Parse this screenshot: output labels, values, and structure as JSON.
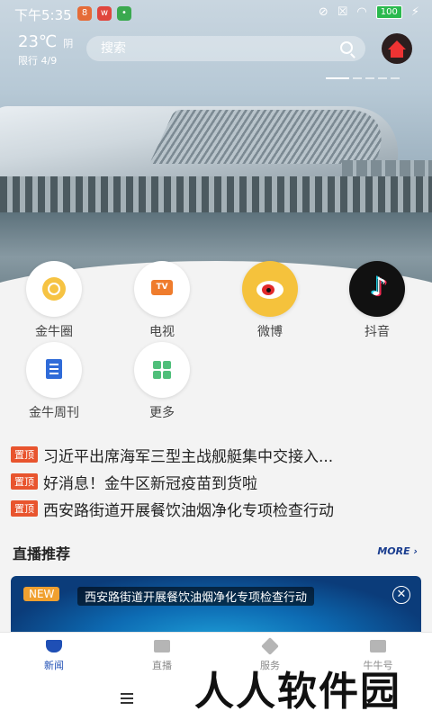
{
  "statusbar": {
    "time": "下午5:35",
    "battery": "100"
  },
  "header": {
    "temperature": "23℃",
    "condition": "阴",
    "restriction": "限行 4/9",
    "search_placeholder": "搜索"
  },
  "shortcuts": [
    {
      "label": "金牛圈",
      "icon": "jinniu-circle-icon"
    },
    {
      "label": "电视",
      "icon": "tv-icon"
    },
    {
      "label": "微博",
      "icon": "weibo-icon"
    },
    {
      "label": "抖音",
      "icon": "douyin-icon"
    },
    {
      "label": "金牛周刊",
      "icon": "weekly-icon"
    },
    {
      "label": "更多",
      "icon": "more-grid-icon"
    }
  ],
  "headlines": [
    {
      "tag": "置顶",
      "text": "习近平出席海军三型主战舰艇集中交接入..."
    },
    {
      "tag": "置顶",
      "text": "好消息！金牛区新冠疫苗到货啦"
    },
    {
      "tag": "置顶",
      "text": "西安路街道开展餐饮油烟净化专项检查行动"
    }
  ],
  "live": {
    "section_title": "直播推荐",
    "more_label": "MORE",
    "badge": "NEW",
    "banner_text": "西安路街道开展餐饮油烟净化专项检查行动"
  },
  "tabs": [
    {
      "label": "新闻",
      "active": true
    },
    {
      "label": "直播",
      "active": false
    },
    {
      "label": "服务",
      "active": false
    },
    {
      "label": "牛牛号",
      "active": false
    }
  ],
  "watermark": "人人软件园",
  "colors": {
    "accent": "#1f4fb5",
    "tag": "#e8542e",
    "badge": "#f0a030"
  }
}
